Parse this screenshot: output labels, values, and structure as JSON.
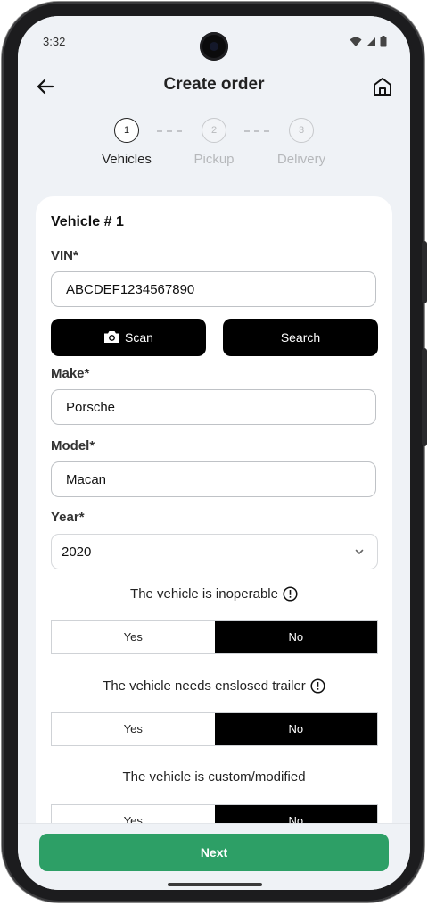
{
  "status": {
    "time": "3:32"
  },
  "header": {
    "title": "Create order"
  },
  "steps": [
    {
      "number": "1",
      "label": "Vehicles"
    },
    {
      "number": "2",
      "label": "Pickup"
    },
    {
      "number": "3",
      "label": "Delivery"
    }
  ],
  "vehicle": {
    "heading": "Vehicle # 1",
    "vin_label": "VIN*",
    "vin_value": "ABCDEF1234567890",
    "scan_label": "Scan",
    "search_label": "Search",
    "make_label": "Make*",
    "make_value": "Porsche",
    "model_label": "Model*",
    "model_value": "Macan",
    "year_label": "Year*",
    "year_value": "2020"
  },
  "questions": [
    {
      "text": "The vehicle is inoperable",
      "yes": "Yes",
      "no": "No",
      "selected": "No",
      "has_info": true
    },
    {
      "text": "The vehicle needs enslosed trailer",
      "yes": "Yes",
      "no": "No",
      "selected": "No",
      "has_info": true
    },
    {
      "text": "The vehicle is custom/modified",
      "yes": "Yes",
      "no": "No",
      "selected": "No",
      "has_info": false
    }
  ],
  "footer": {
    "next_label": "Next"
  },
  "colors": {
    "accent": "#2d9f66",
    "primary_button": "#000000",
    "background": "#eff2f6"
  }
}
